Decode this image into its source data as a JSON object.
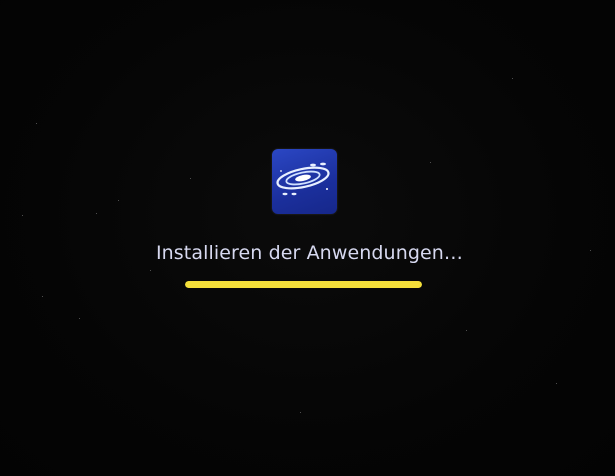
{
  "install_screen": {
    "app_icon": "galaxy-app-icon",
    "status_text": "Installieren der Anwendungen…",
    "progress_fraction": 1.0,
    "progress_color": "#f4df3a",
    "background_color": "#060606"
  }
}
